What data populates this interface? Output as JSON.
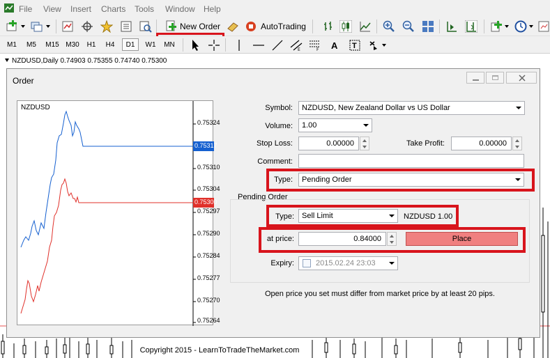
{
  "menu": {
    "items": [
      "File",
      "View",
      "Insert",
      "Charts",
      "Tools",
      "Window",
      "Help"
    ]
  },
  "toolbar": {
    "new_order_label": "New Order",
    "autotrading_label": "AutoTrading",
    "timeframes": [
      "M1",
      "M5",
      "M15",
      "M30",
      "H1",
      "H4",
      "D1",
      "W1",
      "MN"
    ],
    "active_timeframe": "D1"
  },
  "chart": {
    "symbol_line": "NZDUSD,Daily  0.74903 0.75355 0.74740 0.75300"
  },
  "dialog": {
    "title": "Order",
    "mini_chart": {
      "symbol": "NZDUSD",
      "ask_tag": "0.75317",
      "bid_tag": "0.75300",
      "price_labels": [
        "0.75324",
        "0.75310",
        "0.75304",
        "0.75297",
        "0.75290",
        "0.75284",
        "0.75277",
        "0.75270",
        "0.75264"
      ],
      "ask_color": "#1560d0",
      "bid_color": "#e0302a"
    },
    "symbol_label": "Symbol:",
    "symbol_value": "NZDUSD, New Zealand Dollar vs US Dollar",
    "volume_label": "Volume:",
    "volume_value": "1.00",
    "stop_loss_label": "Stop Loss:",
    "stop_loss_value": "0.00000",
    "take_profit_label": "Take Profit:",
    "take_profit_value": "0.00000",
    "comment_label": "Comment:",
    "comment_value": "",
    "type_label": "Type:",
    "type_value": "Pending Order",
    "pending_group_label": "Pending Order",
    "pending_type_label": "Type:",
    "pending_type_value": "Sell Limit",
    "pending_info": "NZDUSD 1.00",
    "at_price_label": "at price:",
    "at_price_value": "0.84000",
    "place_label": "Place",
    "expiry_label": "Expiry:",
    "expiry_value": "2015.02.24 23:03",
    "note": "Open price you set must differ from market price by at least 20 pips."
  },
  "footer": {
    "copyright": "Copyright 2015 - LearnToTradeTheMarket.com"
  },
  "colors": {
    "highlight": "#d8141c",
    "place_button": "#f08080"
  }
}
